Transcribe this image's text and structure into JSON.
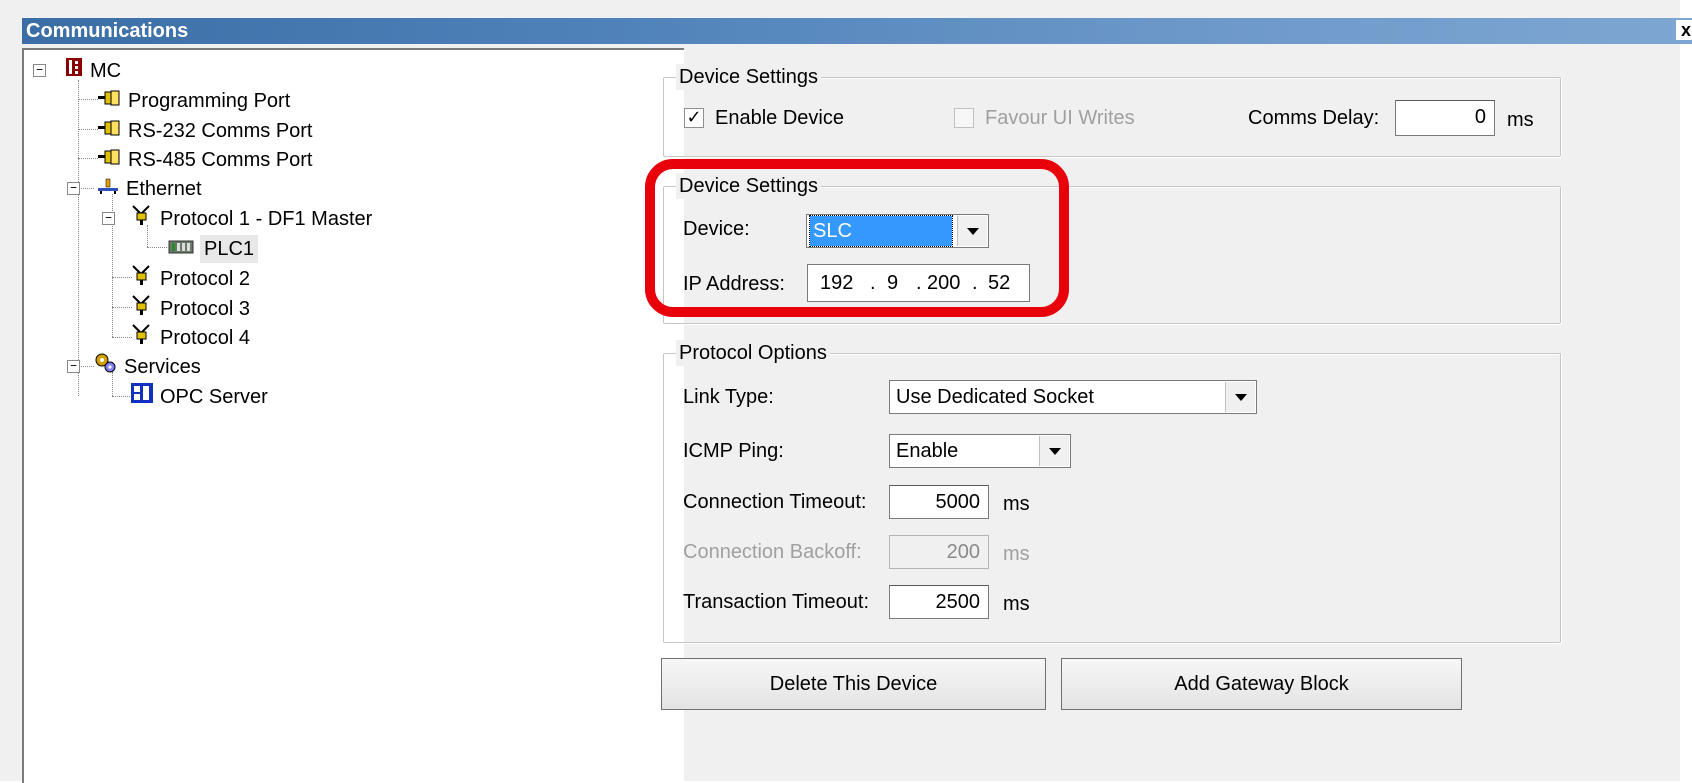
{
  "window": {
    "title": "Communications",
    "close_glyph": "x"
  },
  "tree": {
    "items": [
      {
        "label": "MC",
        "icon": "controller-icon"
      },
      {
        "label": "Programming Port",
        "icon": "port-plug-icon"
      },
      {
        "label": "RS-232 Comms Port",
        "icon": "port-plug-icon"
      },
      {
        "label": "RS-485 Comms Port",
        "icon": "port-plug-icon"
      },
      {
        "label": "Ethernet",
        "icon": "ethernet-network-icon"
      },
      {
        "label": "Protocol 1 - DF1 Master",
        "icon": "protocol-plug-icon"
      },
      {
        "label": "PLC1",
        "icon": "plc-device-icon"
      },
      {
        "label": "Protocol 2",
        "icon": "protocol-plug-icon"
      },
      {
        "label": "Protocol 3",
        "icon": "protocol-plug-icon"
      },
      {
        "label": "Protocol 4",
        "icon": "protocol-plug-icon"
      },
      {
        "label": "Services",
        "icon": "gears-icon"
      },
      {
        "label": "OPC Server",
        "icon": "opc-server-icon"
      }
    ],
    "expander_glyph": "−"
  },
  "device_settings_top": {
    "legend": "Device Settings",
    "enable_device": {
      "label": "Enable Device",
      "checked": true,
      "glyph": "✓"
    },
    "favour_ui_writes": {
      "label": "Favour UI Writes",
      "checked": false,
      "enabled": false
    },
    "comms_delay": {
      "label": "Comms Delay:",
      "value": "0",
      "unit": "ms"
    }
  },
  "device_settings": {
    "legend": "Device Settings",
    "device": {
      "label": "Device:",
      "value": "SLC"
    },
    "ip_address": {
      "label": "IP Address:",
      "octets": [
        "192",
        "9",
        "200",
        "52"
      ],
      "separator": "."
    }
  },
  "protocol_options": {
    "legend": "Protocol Options",
    "link_type": {
      "label": "Link Type:",
      "value": "Use Dedicated Socket"
    },
    "icmp_ping": {
      "label": "ICMP Ping:",
      "value": "Enable"
    },
    "connection_timeout": {
      "label": "Connection Timeout:",
      "value": "5000",
      "unit": "ms"
    },
    "connection_backoff": {
      "label": "Connection Backoff:",
      "value": "200",
      "unit": "ms",
      "enabled": false
    },
    "transaction_timeout": {
      "label": "Transaction Timeout:",
      "value": "2500",
      "unit": "ms"
    }
  },
  "buttons": {
    "delete_device": "Delete This Device",
    "add_gateway_block": "Add Gateway Block"
  },
  "colors": {
    "highlight": "#e8000b",
    "selection": "#3399ff",
    "titlebar": "#3a6ea5"
  }
}
